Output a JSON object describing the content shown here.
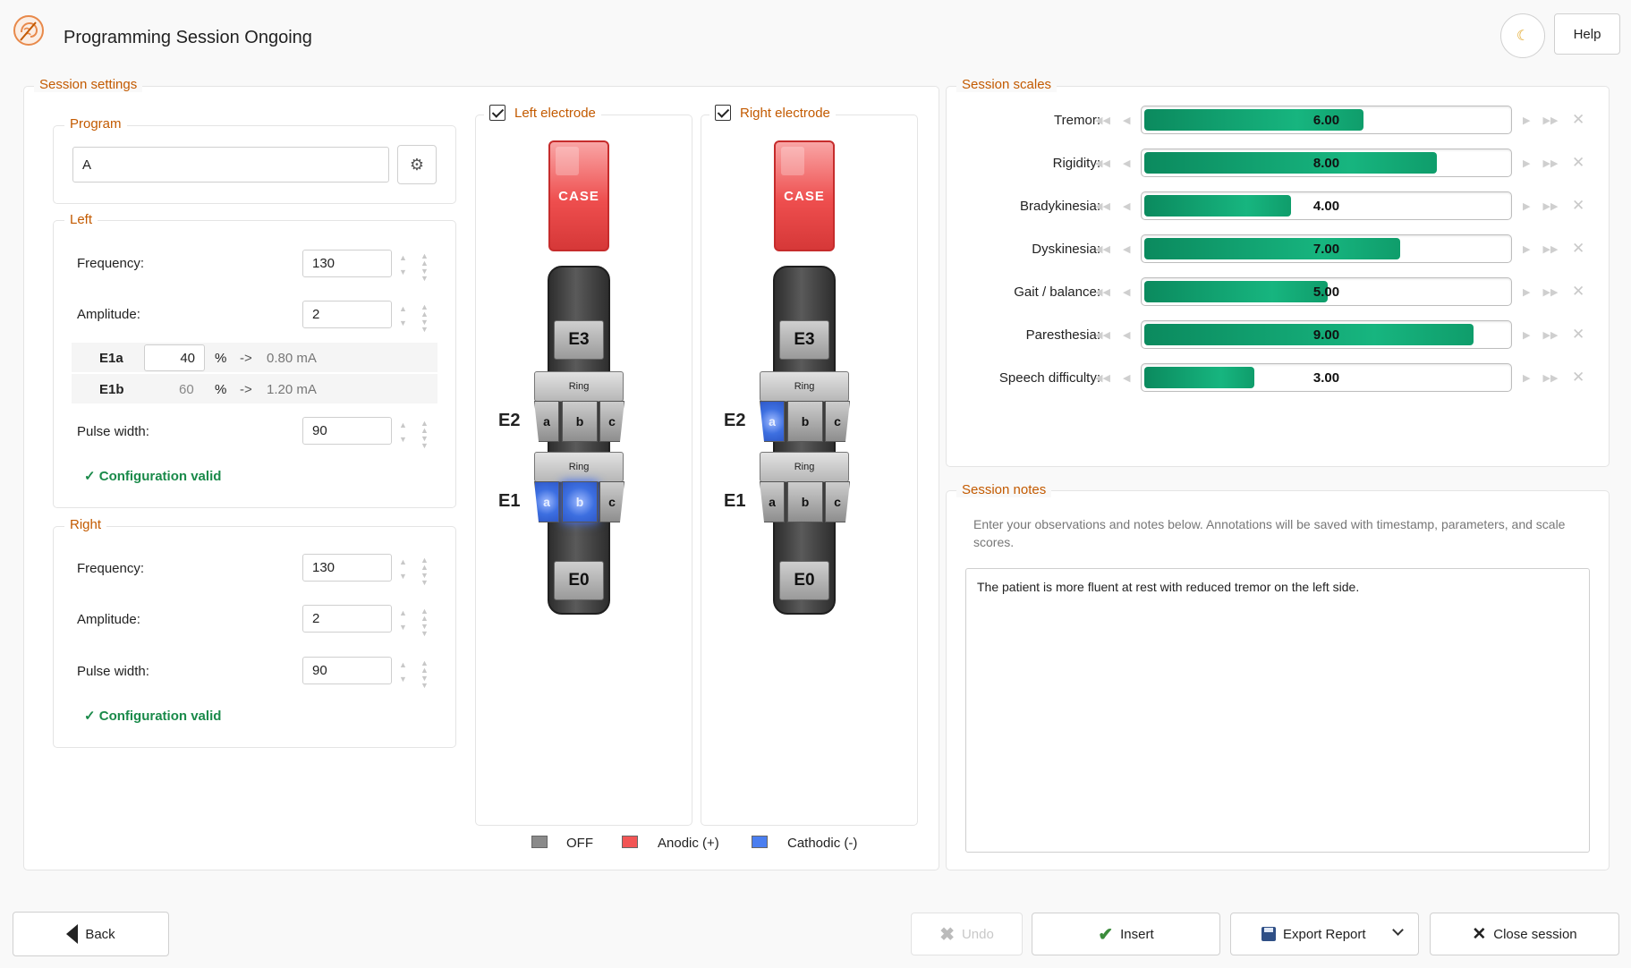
{
  "header": {
    "title": "Programming Session Ongoing",
    "help_label": "Help",
    "theme_icon": "moon-icon",
    "logo_icon": "brain-logo-icon"
  },
  "session_settings": {
    "title": "Session settings",
    "program": {
      "title": "Program",
      "value": "A",
      "settings_icon": "gear-icon"
    },
    "left": {
      "title": "Left",
      "frequency_label": "Frequency:",
      "frequency": "130",
      "amplitude_label": "Amplitude:",
      "amplitude": "2",
      "contacts": [
        {
          "name": "E1a",
          "percent": "40",
          "unit": "%",
          "arrow": "->",
          "current": "0.80 mA"
        },
        {
          "name": "E1b",
          "percent": "60",
          "unit": "%",
          "arrow": "->",
          "current": "1.20 mA"
        }
      ],
      "pulse_width_label": "Pulse width:",
      "pulse_width": "90",
      "status": "✓ Configuration valid"
    },
    "right": {
      "title": "Right",
      "frequency_label": "Frequency:",
      "frequency": "130",
      "amplitude_label": "Amplitude:",
      "amplitude": "2",
      "pulse_width_label": "Pulse width:",
      "pulse_width": "90",
      "status": "✓ Configuration valid"
    }
  },
  "electrodes": {
    "left": {
      "label": "Left electrode",
      "checked": true,
      "case_label": "CASE",
      "e3": "E3",
      "e2": "E2",
      "e1": "E1",
      "e0": "E0",
      "ring": "Ring",
      "seg_a": "a",
      "seg_b": "b",
      "seg_c": "c"
    },
    "right": {
      "label": "Right electrode",
      "checked": true,
      "case_label": "CASE",
      "e3": "E3",
      "e2": "E2",
      "e1": "E1",
      "e0": "E0",
      "ring": "Ring",
      "seg_a": "a",
      "seg_b": "b",
      "seg_c": "c"
    },
    "legend": {
      "off": "OFF",
      "anodic": "Anodic (+)",
      "cathodic": "Cathodic (-)"
    },
    "colors": {
      "off": "#8a8a8a",
      "anodic": "#f25555",
      "cathodic": "#4a7ef0"
    }
  },
  "session_scales": {
    "title": "Session scales",
    "max": 10,
    "items": [
      {
        "label": "Tremor:",
        "value": 6.0,
        "display": "6.00"
      },
      {
        "label": "Rigidity:",
        "value": 8.0,
        "display": "8.00"
      },
      {
        "label": "Bradykinesia:",
        "value": 4.0,
        "display": "4.00"
      },
      {
        "label": "Dyskinesia:",
        "value": 7.0,
        "display": "7.00"
      },
      {
        "label": "Gait / balance:",
        "value": 5.0,
        "display": "5.00"
      },
      {
        "label": "Paresthesia:",
        "value": 9.0,
        "display": "9.00"
      },
      {
        "label": "Speech difficulty:",
        "value": 3.0,
        "display": "3.00"
      }
    ]
  },
  "session_notes": {
    "title": "Session notes",
    "hint": "Enter your observations and notes below. Annotations will be saved with timestamp, parameters, and scale scores.",
    "text": "The patient is more fluent at rest with reduced tremor on the left side."
  },
  "footer": {
    "back": "Back",
    "undo": "Undo",
    "insert": "Insert",
    "export": "Export Report",
    "close": "Close session"
  },
  "accent_color": "#c35a00",
  "valid_color": "#1a8a4a",
  "bar_color": "#12a673"
}
